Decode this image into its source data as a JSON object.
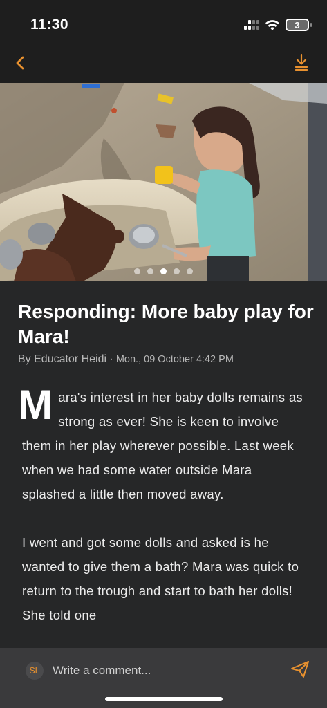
{
  "status_bar": {
    "time": "11:30",
    "battery": "3",
    "icons": [
      "signal-icon",
      "wifi-icon",
      "battery-icon"
    ]
  },
  "nav": {
    "back_icon": "chevron-left-icon",
    "download_icon": "download-icon",
    "accent_color": "#e8912f"
  },
  "photo": {
    "alt": "photo of child playing with baby dolls at a water trough",
    "slides": 5,
    "active_slide": 3
  },
  "post": {
    "title": "Responding: More baby play for Mara!",
    "author": "By Educator Heidi",
    "separator": " · ",
    "date": "Mon., 09 October 4:42 PM",
    "dropcap": "M",
    "para1_rest": "ara's interest in her baby dolls remains as strong as ever! She is keen to involve them in her play wherever possible. Last week when we had some water outside Mara splashed a little then moved away.",
    "para2": "I went and got some dolls and asked is he wanted to give them a bath? Mara was quick to return to the trough and start to bath her dolls! She told one"
  },
  "comment": {
    "avatar_initials": "SL",
    "placeholder": "Write a comment...",
    "send_icon": "send-icon"
  }
}
